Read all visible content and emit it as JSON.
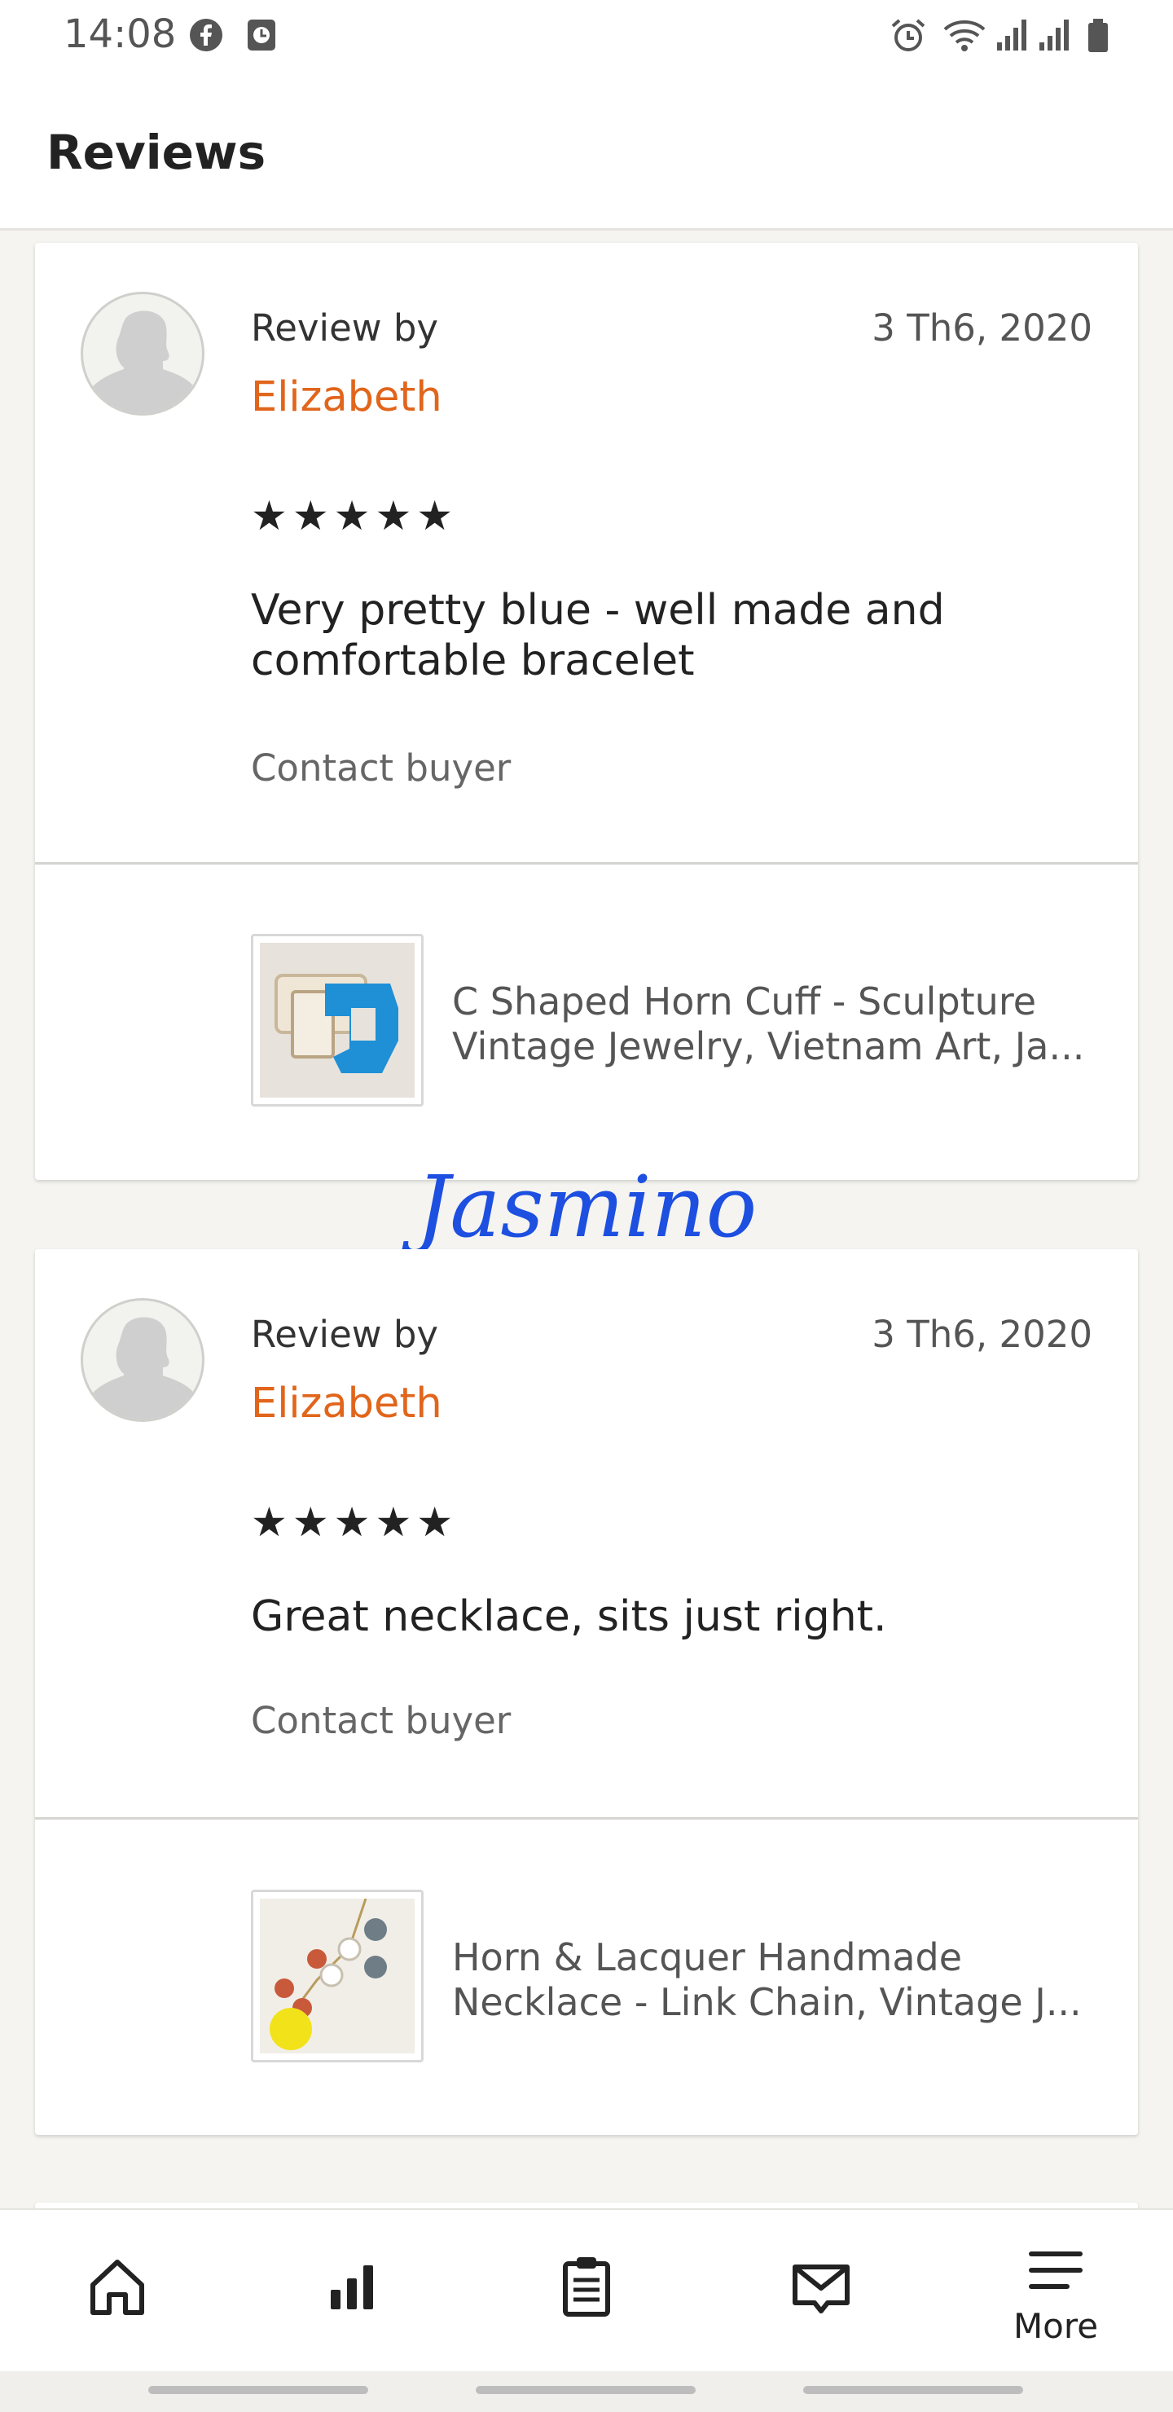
{
  "status_bar": {
    "time": "14:08",
    "icons": [
      "facebook-icon",
      "clock-app-icon",
      "alarm-icon",
      "wifi-icon",
      "signal-icon",
      "signal-icon",
      "battery-icon"
    ]
  },
  "header": {
    "title": "Reviews"
  },
  "reviews": [
    {
      "review_by_label": "Review by",
      "reviewer": "Elizabeth",
      "date": "3 Th6, 2020",
      "rating": 5,
      "stars": "★★★★★",
      "text": "Very pretty blue - well made and comfortable bracelet",
      "contact_label": "Contact buyer",
      "product": {
        "line1": "C Shaped Horn Cuff - Sculpture",
        "line2": "Vintage Jewelry, Vietnam Art, Ja..."
      }
    },
    {
      "review_by_label": "Review by",
      "reviewer": "Elizabeth",
      "date": "3 Th6, 2020",
      "rating": 5,
      "stars": "★★★★★",
      "text": "Great necklace, sits just right.",
      "contact_label": "Contact buyer",
      "product": {
        "line1": "Horn & Lacquer Handmade",
        "line2": "Necklace - Link Chain, Vintage J..."
      }
    }
  ],
  "watermark": "Jasmino",
  "bottom_nav": {
    "items": [
      {
        "icon": "home-icon"
      },
      {
        "icon": "stats-icon"
      },
      {
        "icon": "orders-clipboard-icon"
      },
      {
        "icon": "messages-icon"
      },
      {
        "icon": "menu-icon",
        "label": "More"
      }
    ]
  },
  "colors": {
    "accent_orange": "#e1651b",
    "background": "#f5f4f1",
    "watermark_blue": "#1d4fe0"
  }
}
